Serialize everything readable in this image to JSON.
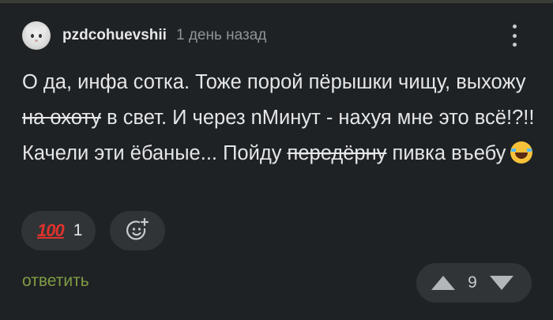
{
  "comment": {
    "author": "pzdcohuevshii",
    "time": "1 день назад",
    "text": {
      "part1": "О да, инфа сотка. Тоже порой пёрышки чищу, выхожу ",
      "strike1": "на охоту",
      "part2": " в свет. И через nМинут - нахуя мне это всё!?!! Качели эти ёбаные... Пойду ",
      "strike2": "передёрну",
      "part3": " пивка въебу"
    },
    "reactions": [
      {
        "emoji": "100",
        "count": "1"
      }
    ],
    "reply_label": "ответить",
    "score": "9"
  },
  "icons": {
    "avatar": "cat-avatar",
    "more": "more-vertical-icon",
    "add_reaction": "add-emoji-icon",
    "upvote": "upvote-icon",
    "downvote": "downvote-icon",
    "laugh": "tears-of-joy-emoji"
  },
  "colors": {
    "background": "#1f2224",
    "reply": "#7f9c45",
    "reaction_bg": "#303437"
  }
}
